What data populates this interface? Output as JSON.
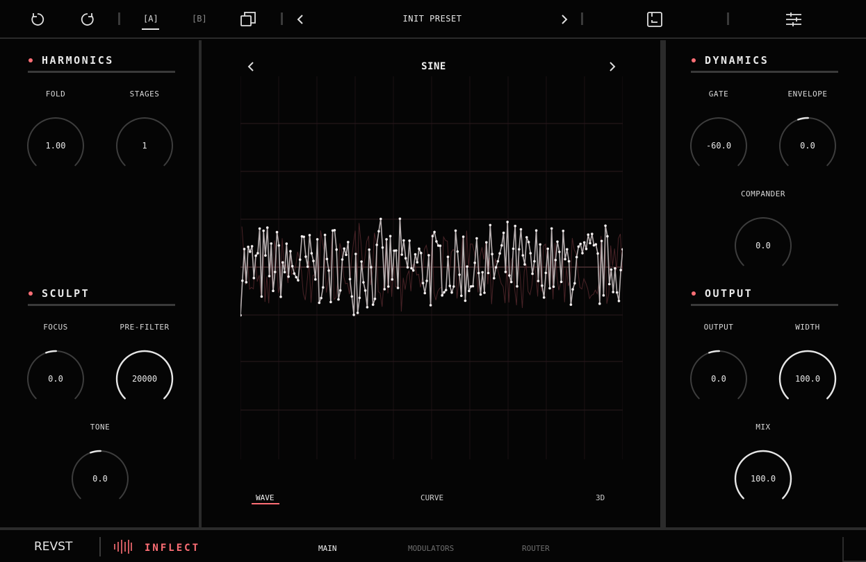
{
  "topbar": {
    "undo_icon": "undo-icon",
    "redo_icon": "redo-icon",
    "slot_a": "[A]",
    "slot_b": "[B]",
    "copy_icon": "copy-icon",
    "preset_name": "INIT PRESET",
    "save_icon": "save-icon",
    "menu_icon": "settings-sliders-icon"
  },
  "harmonics": {
    "title": "HARMONICS",
    "knobs": [
      {
        "label": "FOLD",
        "value": "1.00",
        "fraction": 0
      },
      {
        "label": "STAGES",
        "value": "1",
        "fraction": 0
      }
    ]
  },
  "sculpt": {
    "title": "SCULPT",
    "knobs": [
      {
        "label": "FOCUS",
        "value": "0.0",
        "fraction": 0.5
      },
      {
        "label": "PRE-FILTER",
        "value": "20000",
        "fraction": 1
      },
      {
        "label": "TONE",
        "value": "0.0",
        "fraction": 0.5
      }
    ]
  },
  "dynamics": {
    "title": "DYNAMICS",
    "knobs": [
      {
        "label": "GATE",
        "value": "-60.0",
        "fraction": 0
      },
      {
        "label": "ENVELOPE",
        "value": "0.0",
        "fraction": 0.5
      },
      {
        "label": "COMPANDER",
        "value": "0.0",
        "fraction": 0
      }
    ]
  },
  "output": {
    "title": "OUTPUT",
    "knobs": [
      {
        "label": "OUTPUT",
        "value": "0.0",
        "fraction": 0.5
      },
      {
        "label": "WIDTH",
        "value": "100.0",
        "fraction": 1
      },
      {
        "label": "MIX",
        "value": "100.0",
        "fraction": 1
      }
    ]
  },
  "center": {
    "wave_name": "SINE",
    "tabs": [
      "WAVE",
      "CURVE",
      "3D"
    ],
    "active_tab": "WAVE"
  },
  "bottombar": {
    "brand": "REVST",
    "product": "INFLECT",
    "tabs": [
      "MAIN",
      "MODULATORS",
      "ROUTER"
    ],
    "active_tab": "MAIN"
  },
  "colors": {
    "accent": "#ff6f76",
    "background": "#050505",
    "panel_border": "#2b2b2b",
    "knob_track": "#3d3d3d",
    "knob_fill": "#e6e6e6"
  }
}
